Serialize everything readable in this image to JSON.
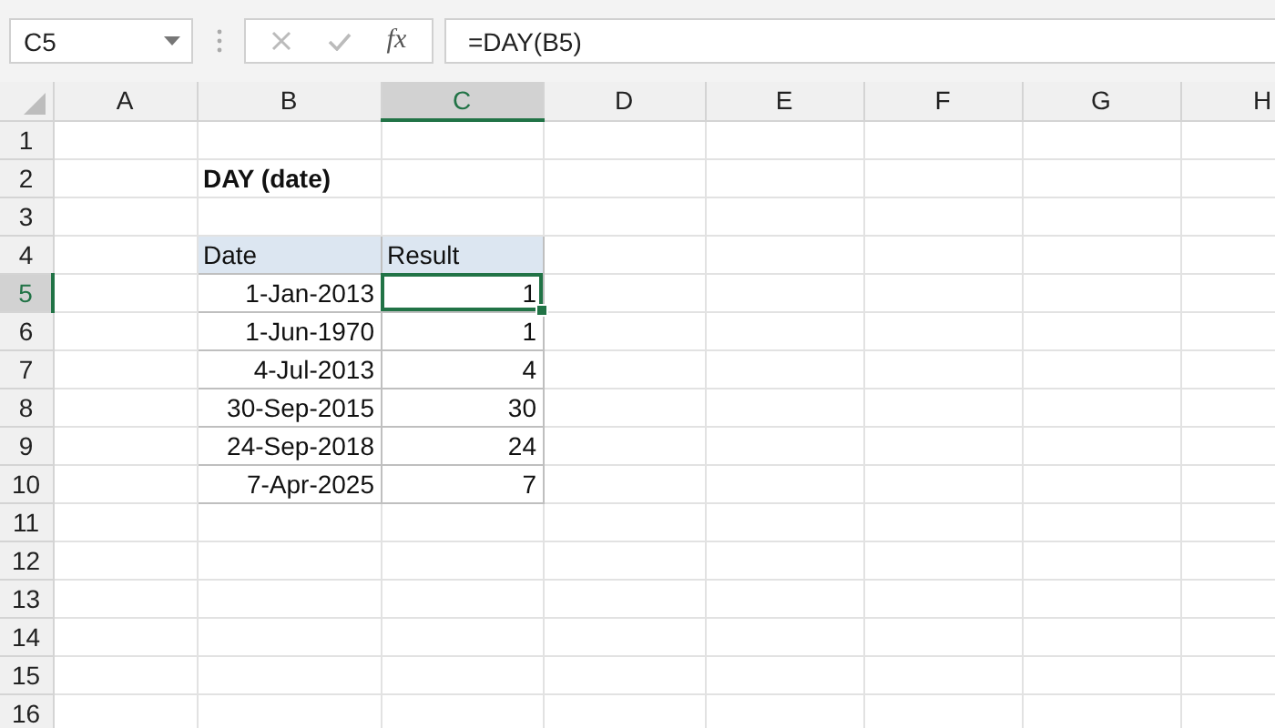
{
  "formula_bar": {
    "name_box": "C5",
    "function_label": "fx",
    "formula": "=DAY(B5)"
  },
  "sheet": {
    "columns": [
      {
        "label": "A",
        "selected": false
      },
      {
        "label": "B",
        "selected": false
      },
      {
        "label": "C",
        "selected": true
      },
      {
        "label": "D",
        "selected": false
      },
      {
        "label": "E",
        "selected": false
      },
      {
        "label": "F",
        "selected": false
      },
      {
        "label": "G",
        "selected": false
      },
      {
        "label": "H",
        "selected": false
      }
    ],
    "rows": [
      {
        "label": "1",
        "selected": false
      },
      {
        "label": "2",
        "selected": false
      },
      {
        "label": "3",
        "selected": false
      },
      {
        "label": "4",
        "selected": false
      },
      {
        "label": "5",
        "selected": true
      },
      {
        "label": "6",
        "selected": false
      },
      {
        "label": "7",
        "selected": false
      },
      {
        "label": "8",
        "selected": false
      },
      {
        "label": "9",
        "selected": false
      },
      {
        "label": "10",
        "selected": false
      },
      {
        "label": "11",
        "selected": false
      },
      {
        "label": "12",
        "selected": false
      },
      {
        "label": "13",
        "selected": false
      },
      {
        "label": "14",
        "selected": false
      },
      {
        "label": "15",
        "selected": false
      },
      {
        "label": "16",
        "selected": false
      }
    ],
    "title": "DAY (date)",
    "table": {
      "headers": [
        "Date",
        "Result"
      ],
      "rows": [
        {
          "date": "1-Jan-2013",
          "result": "1",
          "selected": true
        },
        {
          "date": "1-Jun-1970",
          "result": "1",
          "selected": false
        },
        {
          "date": "4-Jul-2013",
          "result": "4",
          "selected": false
        },
        {
          "date": "30-Sep-2015",
          "result": "30",
          "selected": false
        },
        {
          "date": "24-Sep-2018",
          "result": "24",
          "selected": false
        },
        {
          "date": "7-Apr-2025",
          "result": "7",
          "selected": false
        }
      ]
    }
  }
}
